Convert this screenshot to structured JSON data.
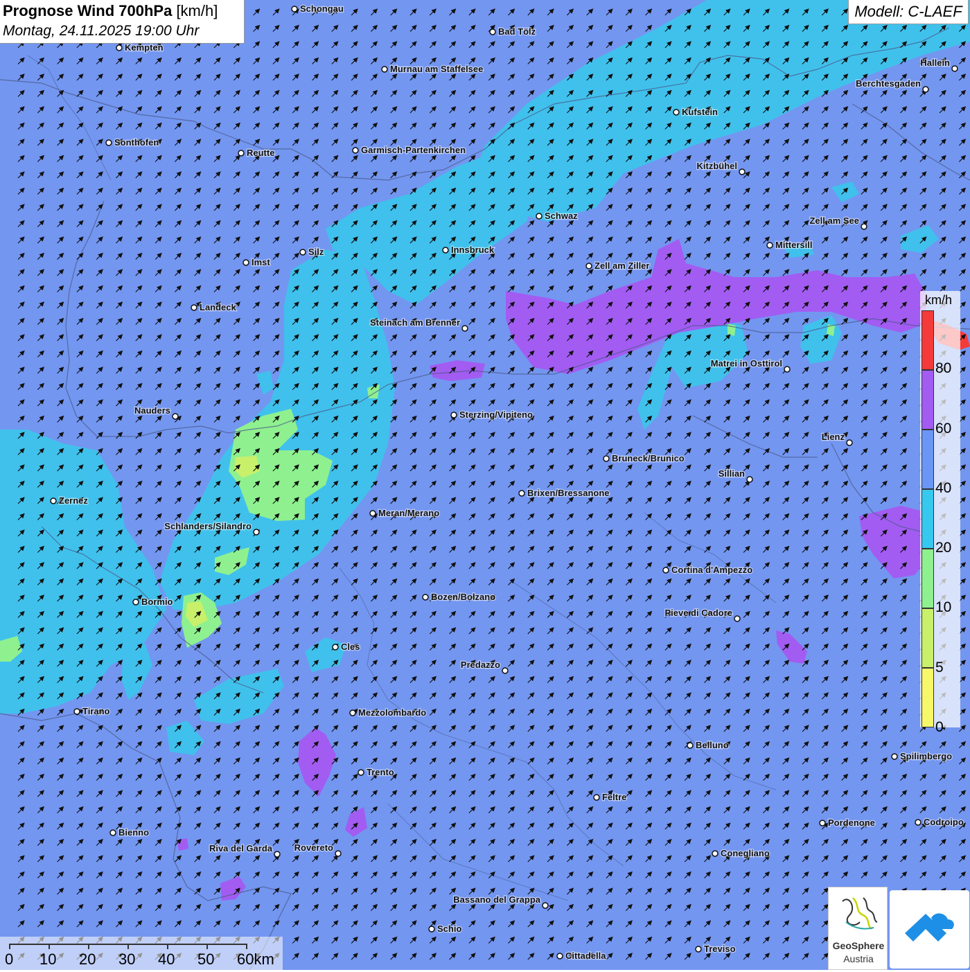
{
  "header": {
    "title_bold": "Prognose Wind 700hPa",
    "title_unit": "[km/h]",
    "datetime": "Montag, 24.11.2025 19:00 Uhr"
  },
  "model": "Modell: C-LAEF",
  "legend": {
    "unit": "km/h",
    "bands": [
      {
        "from": 0,
        "to": 5,
        "color": "#f7f76a"
      },
      {
        "from": 5,
        "to": 10,
        "color": "#c8f06a"
      },
      {
        "from": 10,
        "to": 20,
        "color": "#8ff08f"
      },
      {
        "from": 20,
        "to": 40,
        "color": "#36c8ee"
      },
      {
        "from": 40,
        "to": 60,
        "color": "#6a96f5"
      },
      {
        "from": 60,
        "to": 80,
        "color": "#a25cf2"
      },
      {
        "from": 80,
        "to": 100,
        "color": "#f53a3a"
      }
    ],
    "ticks": [
      "80",
      "60",
      "40",
      "20",
      "10",
      "5",
      "0"
    ]
  },
  "scalebar": {
    "labels": [
      "0",
      "10",
      "20",
      "30",
      "40",
      "50",
      "60km"
    ]
  },
  "logos": {
    "geosphere_name": "GeoSphere",
    "geosphere_sub": "Austria"
  },
  "colors": {
    "background_40_60": "#7396f0",
    "wind_20_40": "#3cc4ec",
    "wind_10_20": "#8ff08f",
    "wind_5_10": "#c8f06a",
    "wind_60_80": "#a25cf2",
    "wind_80_plus": "#f53a3a",
    "arrow": "#111111"
  },
  "wind_direction": "southwest wind (arrows pointing toward north-east)",
  "cities": [
    {
      "name": "Schongau",
      "side": "right"
    },
    {
      "name": "Bad Tölz",
      "side": "right"
    },
    {
      "name": "Kempten",
      "side": "right"
    },
    {
      "name": "Murnau am Staffelsee",
      "side": "right"
    },
    {
      "name": "Hallein",
      "side": "left"
    },
    {
      "name": "Berchtesgaden",
      "side": "left"
    },
    {
      "name": "Kufstein",
      "side": "right"
    },
    {
      "name": "Sonthofen",
      "side": "right"
    },
    {
      "name": "Reutte",
      "side": "right"
    },
    {
      "name": "Garmisch-Partenkirchen",
      "side": "right"
    },
    {
      "name": "Kitzbühel",
      "side": "left"
    },
    {
      "name": "Schwaz",
      "side": "right"
    },
    {
      "name": "Zell am See",
      "side": "left"
    },
    {
      "name": "Mittersill",
      "side": "right"
    },
    {
      "name": "Innsbruck",
      "side": "right"
    },
    {
      "name": "Silz",
      "side": "right"
    },
    {
      "name": "Imst",
      "side": "right"
    },
    {
      "name": "Zell am Ziller",
      "side": "right"
    },
    {
      "name": "Landeck",
      "side": "right"
    },
    {
      "name": "Steinach am Brenner",
      "side": "left"
    },
    {
      "name": "Matrei in Osttirol",
      "side": "left"
    },
    {
      "name": "Nauders",
      "side": "left"
    },
    {
      "name": "Sterzing/Vipiteno",
      "side": "right"
    },
    {
      "name": "Lienz",
      "side": "left"
    },
    {
      "name": "Bruneck/Brunico",
      "side": "right"
    },
    {
      "name": "Sillian",
      "side": "left"
    },
    {
      "name": "Brixen/Bressanone",
      "side": "right"
    },
    {
      "name": "Zernez",
      "side": "right"
    },
    {
      "name": "Meran/Merano",
      "side": "right"
    },
    {
      "name": "Schlanders/Silandro",
      "side": "left"
    },
    {
      "name": "Cortina d'Ampezzo",
      "side": "right"
    },
    {
      "name": "Bozen/Bolzano",
      "side": "right"
    },
    {
      "name": "Bormio",
      "side": "right"
    },
    {
      "name": "Pieve di Cadore",
      "side": "left"
    },
    {
      "name": "Cles",
      "side": "right"
    },
    {
      "name": "Predazzo",
      "side": "left"
    },
    {
      "name": "Tirano",
      "side": "right"
    },
    {
      "name": "Mezzolombardo",
      "side": "right"
    },
    {
      "name": "Belluno",
      "side": "right"
    },
    {
      "name": "Spilimbergo",
      "side": "right"
    },
    {
      "name": "Trento",
      "side": "right"
    },
    {
      "name": "Feltre",
      "side": "right"
    },
    {
      "name": "Pordenone",
      "side": "right"
    },
    {
      "name": "Codroipo",
      "side": "right"
    },
    {
      "name": "Bienno",
      "side": "right"
    },
    {
      "name": "Riva del Garda",
      "side": "left"
    },
    {
      "name": "Rovereto",
      "side": "left"
    },
    {
      "name": "Conegliano",
      "side": "right"
    },
    {
      "name": "Bassano del Grappa",
      "side": "left"
    },
    {
      "name": "Schio",
      "side": "right"
    },
    {
      "name": "Treviso",
      "side": "right"
    },
    {
      "name": "Cittadella",
      "side": "right"
    }
  ]
}
